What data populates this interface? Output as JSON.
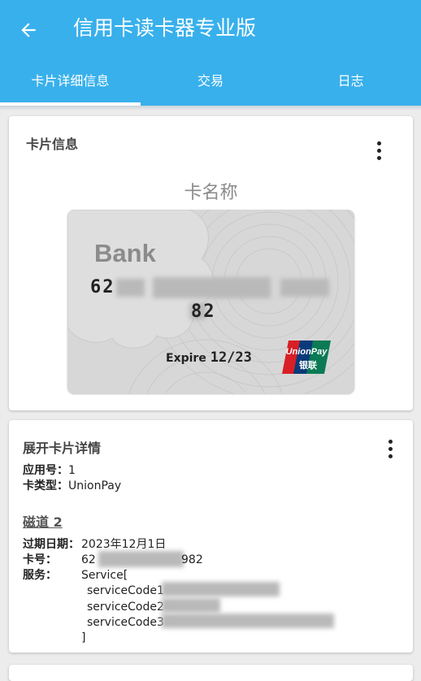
{
  "appbar": {
    "title": "信用卡读卡器专业版",
    "tabs": [
      "卡片详细信息",
      "交易",
      "日志"
    ],
    "color": "#38b0ec"
  },
  "card_info": {
    "section_title": "卡片信息",
    "card_name": "卡名称",
    "bank": "Bank",
    "number_prefix": "62",
    "number_line2": "82",
    "expire_label": "Expire",
    "expire_value": "12/23",
    "logo_top": "UnionPay",
    "logo_bottom": "银联"
  },
  "details": {
    "section_title": "展开卡片详情",
    "app_no_label": "应用号：",
    "app_no": "1",
    "card_type_label": "卡类型：",
    "card_type": "UnionPay",
    "track_title": "磁道 2",
    "expiry_label": "过期日期：",
    "expiry": "2023年12月1日",
    "cardno_label": "卡号：",
    "cardno_prefix": "62",
    "cardno_suffix": "982",
    "service_label": "服务：",
    "service_open": "Service[",
    "service_codes": [
      "serviceCode1=",
      "serviceCode2=",
      "serviceCode3="
    ],
    "service_close": "]"
  }
}
